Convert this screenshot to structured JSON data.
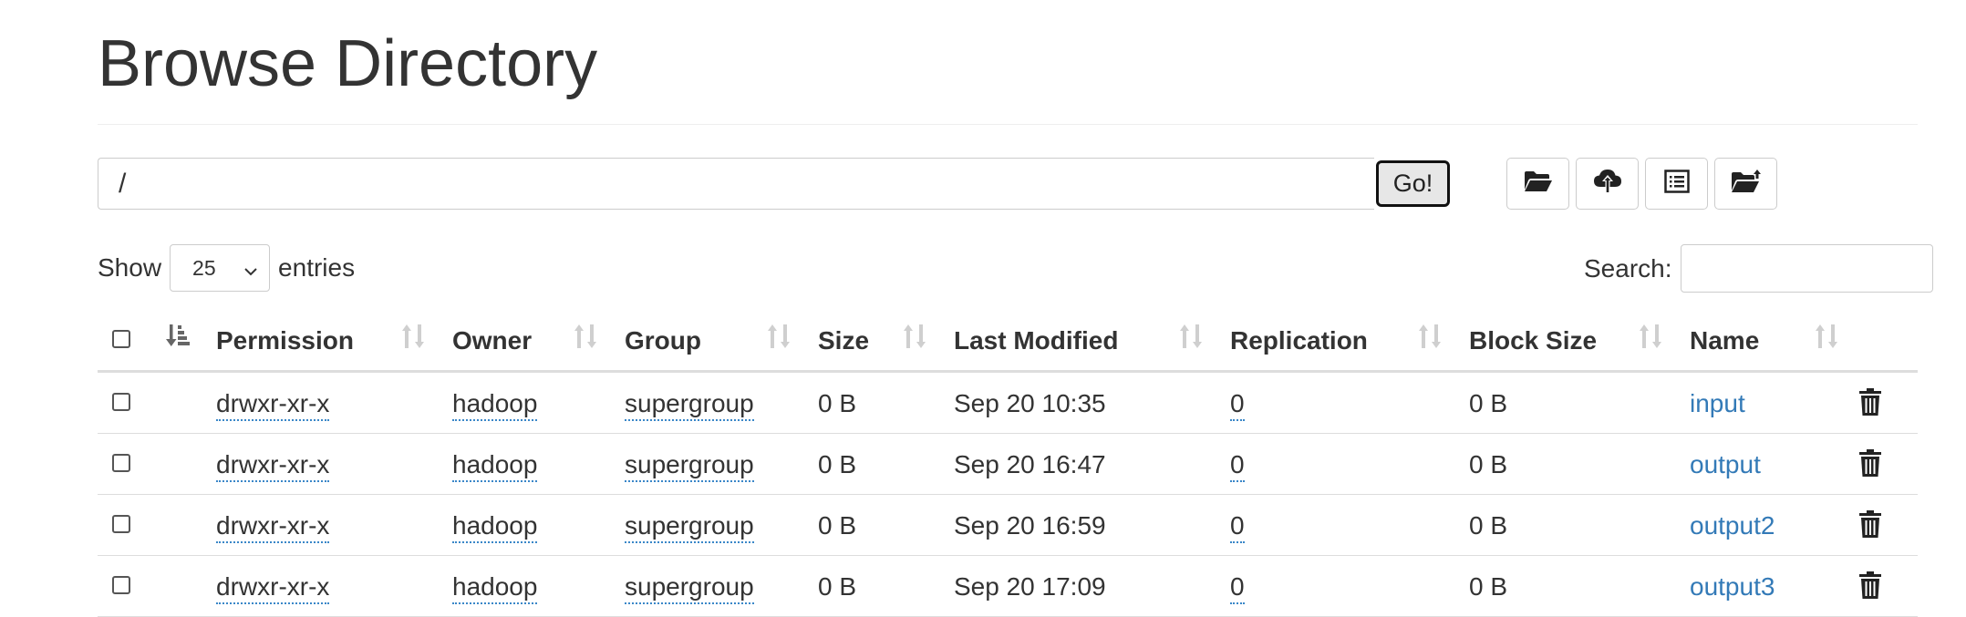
{
  "page": {
    "title": "Browse Directory"
  },
  "path_bar": {
    "value": "/",
    "go_label": "Go!"
  },
  "toolbar": {
    "buttons": [
      {
        "icon": "folder-open-icon"
      },
      {
        "icon": "cloud-upload-icon"
      },
      {
        "icon": "list-alt-icon"
      },
      {
        "icon": "folder-upload-icon"
      }
    ]
  },
  "length_menu": {
    "show_label": "Show",
    "value": "25",
    "entries_label": "entries"
  },
  "search": {
    "label": "Search:",
    "value": ""
  },
  "table": {
    "columns": [
      "Permission",
      "Owner",
      "Group",
      "Size",
      "Last Modified",
      "Replication",
      "Block Size",
      "Name"
    ],
    "rows": [
      {
        "permission": "drwxr-xr-x",
        "owner": "hadoop",
        "group": "supergroup",
        "size": "0 B",
        "modified": "Sep 20 10:35",
        "replication": "0",
        "block_size": "0 B",
        "name": "input"
      },
      {
        "permission": "drwxr-xr-x",
        "owner": "hadoop",
        "group": "supergroup",
        "size": "0 B",
        "modified": "Sep 20 16:47",
        "replication": "0",
        "block_size": "0 B",
        "name": "output"
      },
      {
        "permission": "drwxr-xr-x",
        "owner": "hadoop",
        "group": "supergroup",
        "size": "0 B",
        "modified": "Sep 20 16:59",
        "replication": "0",
        "block_size": "0 B",
        "name": "output2"
      },
      {
        "permission": "drwxr-xr-x",
        "owner": "hadoop",
        "group": "supergroup",
        "size": "0 B",
        "modified": "Sep 20 17:09",
        "replication": "0",
        "block_size": "0 B",
        "name": "output3"
      }
    ]
  },
  "colors": {
    "link": "#337ab7",
    "border": "#dddddd",
    "text": "#333333"
  }
}
